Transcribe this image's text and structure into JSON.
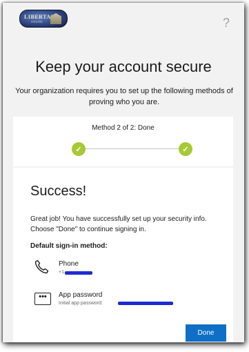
{
  "header": {
    "logo_text": "LIBERTAS",
    "logo_subtext": "ONLINE",
    "help_glyph": "?"
  },
  "page": {
    "title": "Keep your account secure",
    "subtitle": "Your organization requires you to set up the following methods of proving who you are."
  },
  "progress": {
    "method_label": "Method 2 of 2: Done",
    "step1_glyph": "✓",
    "step2_glyph": "✓",
    "completed_steps": 2,
    "total_steps": 2,
    "step_color": "#a7c935"
  },
  "result": {
    "heading": "Success!",
    "message": "Great job! You have successfully set up your security info. Choose \"Done\" to continue signing in.",
    "default_label": "Default sign-in method:"
  },
  "methods": [
    {
      "icon": "phone-icon",
      "title": "Phone",
      "detail": "+1"
    },
    {
      "icon": "app-password-icon",
      "title": "App password",
      "detail": "Initial app password:"
    }
  ],
  "actions": {
    "done_label": "Done",
    "accent_color": "#0f6fc6"
  }
}
